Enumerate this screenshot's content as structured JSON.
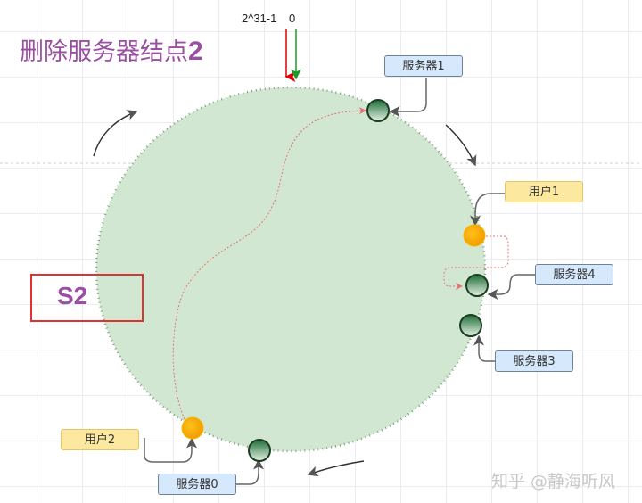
{
  "title": {
    "text": "删除服务器结点",
    "number": "2"
  },
  "ring_markers": {
    "max": "2^31-1",
    "zero": "0"
  },
  "highlight_label": "S2",
  "servers": [
    "服务器0",
    "服务器1",
    "服务器3",
    "服务器4"
  ],
  "users": [
    "用户1",
    "用户2"
  ],
  "watermark": "知乎 @静海听风",
  "colors": {
    "ring_fill": "#d2e7d2",
    "title": "#9a4fa3",
    "server_box": "#d6e8fb",
    "user_box": "#fde8a0",
    "user_node": "#f5a800",
    "path": "#e57373"
  }
}
